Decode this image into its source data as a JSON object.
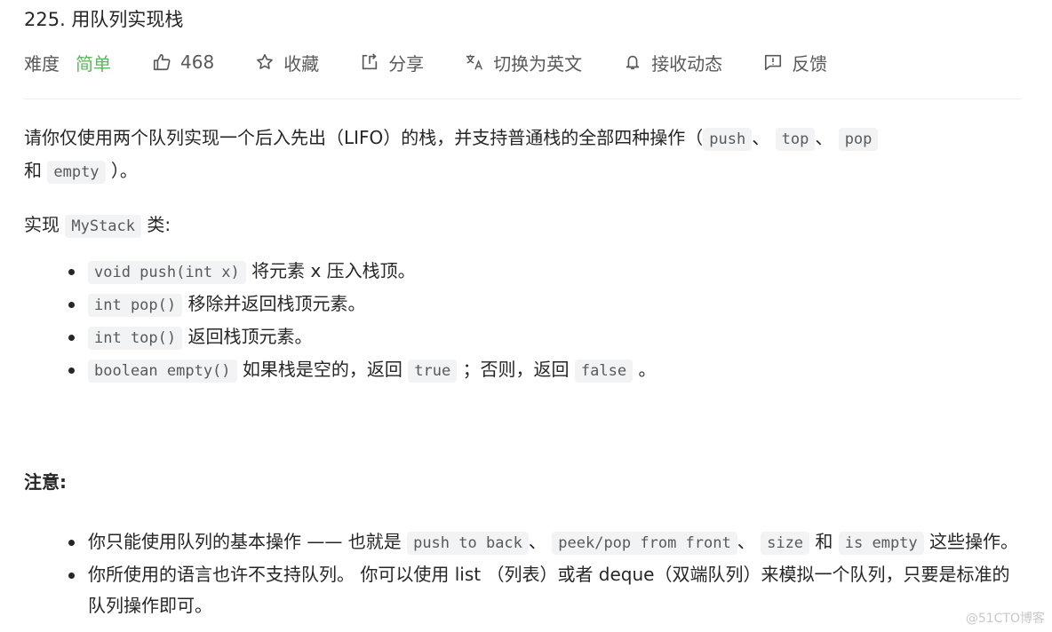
{
  "problem": {
    "title": "225. 用队列实现栈"
  },
  "meta": {
    "difficulty_label": "难度",
    "difficulty_value": "简单",
    "difficulty_color": "#5cb85c",
    "likes": "468",
    "favorite_label": "收藏",
    "share_label": "分享",
    "switch_lang_label": "切换为英文",
    "subscribe_label": "接收动态",
    "feedback_label": "反馈"
  },
  "description": {
    "intro_text_1": "请你仅使用两个队列实现一个后入先出（LIFO）的栈，并支持普通栈的全部四种操作（",
    "op_push": "push",
    "sep1": "、",
    "op_top": "top",
    "sep2": "、",
    "op_pop": "pop",
    "intro_text_2": "和",
    "op_empty": "empty",
    "intro_text_3": "）。",
    "impl_prefix": "实现",
    "impl_class": "MyStack",
    "impl_suffix": "类:",
    "methods": [
      {
        "code": "void push(int x)",
        "text": "将元素 x 压入栈顶。"
      },
      {
        "code": "int pop()",
        "text": "移除并返回栈顶元素。"
      },
      {
        "code": "int top()",
        "text": "返回栈顶元素。"
      },
      {
        "code": "boolean empty()",
        "text": "如果栈是空的，返回",
        "code2": "true",
        "text2": "；否则，返回",
        "code3": "false",
        "text3": "。"
      }
    ]
  },
  "notes": {
    "title": "注意:",
    "items": [
      {
        "text1": "你只能使用队列的基本操作 —— 也就是",
        "code1": "push to back",
        "sep1": "、",
        "code2": "peek/pop from front",
        "sep2": "、",
        "code3": "size",
        "text2": "和",
        "code4": "is empty",
        "text3": "这些操作。"
      },
      {
        "text": "你所使用的语言也许不支持队列。 你可以使用 list （列表）或者 deque（双端队列）来模拟一个队列，只要是标准的队列操作即可。"
      }
    ]
  },
  "watermark": "@51CTO博客"
}
